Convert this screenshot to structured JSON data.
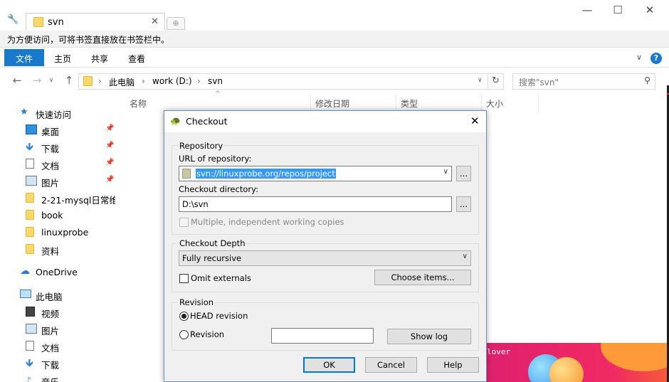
{
  "browser": {
    "tab_title": "svn",
    "bookmark_hint": "为方便访问，可将书签直接放在书签栏中。"
  },
  "ribbon": {
    "tabs": [
      "文件",
      "主页",
      "共享",
      "查看"
    ]
  },
  "address": {
    "crumbs": [
      "此电脑",
      "work (D:)",
      "svn"
    ],
    "search_placeholder": "搜索\"svn\""
  },
  "sidebar": {
    "quick_access": "快速访问",
    "quick_items": [
      "桌面",
      "下载",
      "文档",
      "图片",
      "2-21-mysql日常维",
      "book",
      "linuxprobe",
      "资料"
    ],
    "onedrive": "OneDrive",
    "this_pc": "此电脑",
    "pc_items": [
      "视频",
      "图片",
      "文档",
      "下载",
      "音乐"
    ]
  },
  "columns": [
    "名称",
    "修改日期",
    "类型",
    "大小"
  ],
  "dialog": {
    "title": "Checkout",
    "repository_group": "Repository",
    "url_label": "URL of repository:",
    "url_value": "svn://linuxprobe.org/repos/project",
    "browse_label": "...",
    "dir_label": "Checkout directory:",
    "dir_value": "D:\\svn",
    "multiple_label": "Multiple, independent working copies",
    "depth_group": "Checkout Depth",
    "depth_value": "Fully recursive",
    "omit_label": "Omit externals",
    "choose_label": "Choose items...",
    "revision_group": "Revision",
    "head_label": "HEAD revision",
    "revision_label": "Revision",
    "showlog_label": "Show log",
    "ok_label": "OK",
    "cancel_label": "Cancel",
    "help_label": "Help"
  },
  "banner_text": "lover",
  "colors": {
    "accent": "#1979ca",
    "selection": "#3399ff",
    "banner": "#e0206e"
  }
}
